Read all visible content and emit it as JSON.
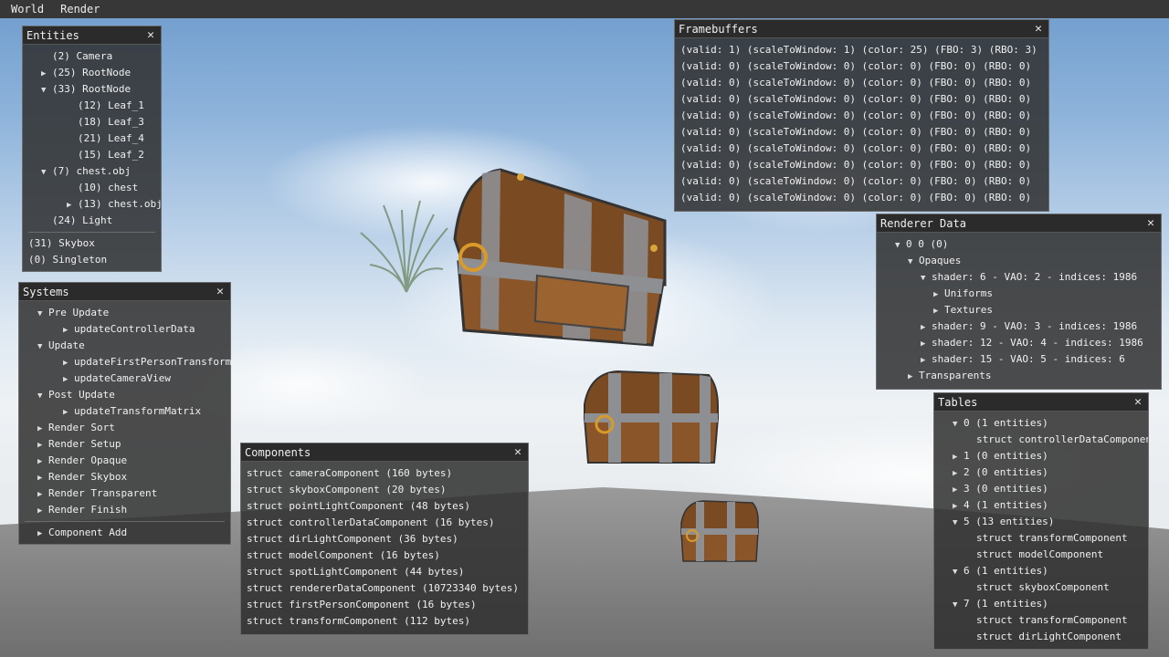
{
  "menubar": {
    "items": [
      "World",
      "Render"
    ]
  },
  "entities": {
    "title": "Entities",
    "items": [
      {
        "label": "(2) Camera",
        "indent": 1,
        "arrow": "none"
      },
      {
        "label": "(25) RootNode",
        "indent": 1,
        "arrow": "right"
      },
      {
        "label": "(33) RootNode",
        "indent": 1,
        "arrow": "down"
      },
      {
        "label": "(12) Leaf_1",
        "indent": 3,
        "arrow": "none"
      },
      {
        "label": "(18) Leaf_3",
        "indent": 3,
        "arrow": "none"
      },
      {
        "label": "(21) Leaf_4",
        "indent": 3,
        "arrow": "none"
      },
      {
        "label": "(15) Leaf_2",
        "indent": 3,
        "arrow": "none"
      },
      {
        "label": "(7) chest.obj",
        "indent": 1,
        "arrow": "down"
      },
      {
        "label": "(10) chest",
        "indent": 3,
        "arrow": "none"
      },
      {
        "label": "(13) chest.obj",
        "indent": 3,
        "arrow": "right"
      },
      {
        "label": "(24) Light",
        "indent": 1,
        "arrow": "none"
      }
    ],
    "footer": [
      "(31) Skybox",
      "(0) Singleton"
    ]
  },
  "systems": {
    "title": "Systems",
    "items": [
      {
        "label": "Pre Update",
        "indent": 1,
        "arrow": "down"
      },
      {
        "label": "updateControllerData",
        "indent": 3,
        "arrow": "right"
      },
      {
        "label": "Update",
        "indent": 1,
        "arrow": "down"
      },
      {
        "label": "updateFirstPersonTransform",
        "indent": 3,
        "arrow": "right"
      },
      {
        "label": "updateCameraView",
        "indent": 3,
        "arrow": "right"
      },
      {
        "label": "Post Update",
        "indent": 1,
        "arrow": "down"
      },
      {
        "label": "updateTransformMatrix",
        "indent": 3,
        "arrow": "right"
      },
      {
        "label": "Render Sort",
        "indent": 1,
        "arrow": "right"
      },
      {
        "label": "Render Setup",
        "indent": 1,
        "arrow": "right"
      },
      {
        "label": "Render Opaque",
        "indent": 1,
        "arrow": "right"
      },
      {
        "label": "Render Skybox",
        "indent": 1,
        "arrow": "right"
      },
      {
        "label": "Render Transparent",
        "indent": 1,
        "arrow": "right"
      },
      {
        "label": "Render Finish",
        "indent": 1,
        "arrow": "right"
      }
    ],
    "footer": "Component Add"
  },
  "components": {
    "title": "Components",
    "items": [
      "struct cameraComponent (160 bytes)",
      "struct skyboxComponent (20 bytes)",
      "struct pointLightComponent (48 bytes)",
      "struct controllerDataComponent (16 bytes)",
      "struct dirLightComponent (36 bytes)",
      "struct modelComponent (16 bytes)",
      "struct spotLightComponent (44 bytes)",
      "struct rendererDataComponent (10723340 bytes)",
      "struct firstPersonComponent (16 bytes)",
      "struct transformComponent (112 bytes)"
    ]
  },
  "framebuffers": {
    "title": "Framebuffers",
    "items": [
      "(valid: 1) (scaleToWindow: 1) (color: 25) (FBO: 3) (RBO: 3)",
      "(valid: 0) (scaleToWindow: 0) (color: 0) (FBO: 0) (RBO: 0)",
      "(valid: 0) (scaleToWindow: 0) (color: 0) (FBO: 0) (RBO: 0)",
      "(valid: 0) (scaleToWindow: 0) (color: 0) (FBO: 0) (RBO: 0)",
      "(valid: 0) (scaleToWindow: 0) (color: 0) (FBO: 0) (RBO: 0)",
      "(valid: 0) (scaleToWindow: 0) (color: 0) (FBO: 0) (RBO: 0)",
      "(valid: 0) (scaleToWindow: 0) (color: 0) (FBO: 0) (RBO: 0)",
      "(valid: 0) (scaleToWindow: 0) (color: 0) (FBO: 0) (RBO: 0)",
      "(valid: 0) (scaleToWindow: 0) (color: 0) (FBO: 0) (RBO: 0)",
      "(valid: 0) (scaleToWindow: 0) (color: 0) (FBO: 0) (RBO: 0)"
    ]
  },
  "renderer": {
    "title": "Renderer Data",
    "items": [
      {
        "label": "0 0 (0)",
        "indent": 1,
        "arrow": "down"
      },
      {
        "label": "Opaques",
        "indent": 2,
        "arrow": "down"
      },
      {
        "label": "shader: 6 - VAO: 2 - indices: 1986",
        "indent": 3,
        "arrow": "down"
      },
      {
        "label": "Uniforms",
        "indent": 4,
        "arrow": "right"
      },
      {
        "label": "Textures",
        "indent": 4,
        "arrow": "right"
      },
      {
        "label": "shader: 9 - VAO: 3 - indices: 1986",
        "indent": 3,
        "arrow": "right"
      },
      {
        "label": "shader: 12 - VAO: 4 - indices: 1986",
        "indent": 3,
        "arrow": "right"
      },
      {
        "label": "shader: 15 - VAO: 5 - indices: 6",
        "indent": 3,
        "arrow": "right"
      },
      {
        "label": "Transparents",
        "indent": 2,
        "arrow": "right"
      }
    ]
  },
  "tables": {
    "title": "Tables",
    "items": [
      {
        "label": "0 (1 entities)",
        "indent": 1,
        "arrow": "down"
      },
      {
        "label": "struct controllerDataComponent",
        "indent": 2,
        "arrow": "none"
      },
      {
        "label": "1 (0 entities)",
        "indent": 1,
        "arrow": "right"
      },
      {
        "label": "2 (0 entities)",
        "indent": 1,
        "arrow": "right"
      },
      {
        "label": "3 (0 entities)",
        "indent": 1,
        "arrow": "right"
      },
      {
        "label": "4 (1 entities)",
        "indent": 1,
        "arrow": "right"
      },
      {
        "label": "5 (13 entities)",
        "indent": 1,
        "arrow": "down"
      },
      {
        "label": "struct transformComponent",
        "indent": 2,
        "arrow": "none"
      },
      {
        "label": "struct modelComponent",
        "indent": 2,
        "arrow": "none"
      },
      {
        "label": "6 (1 entities)",
        "indent": 1,
        "arrow": "down"
      },
      {
        "label": "struct skyboxComponent",
        "indent": 2,
        "arrow": "none"
      },
      {
        "label": "7 (1 entities)",
        "indent": 1,
        "arrow": "down"
      },
      {
        "label": "struct transformComponent",
        "indent": 2,
        "arrow": "none"
      },
      {
        "label": "struct dirLightComponent",
        "indent": 2,
        "arrow": "none"
      }
    ]
  },
  "colors": {
    "window_bg": "#303030",
    "title_bg": "#2b2b2b",
    "text": "#f0f0f0",
    "ground": "#8a8a8a",
    "sky_top": "#6f9ccd"
  }
}
